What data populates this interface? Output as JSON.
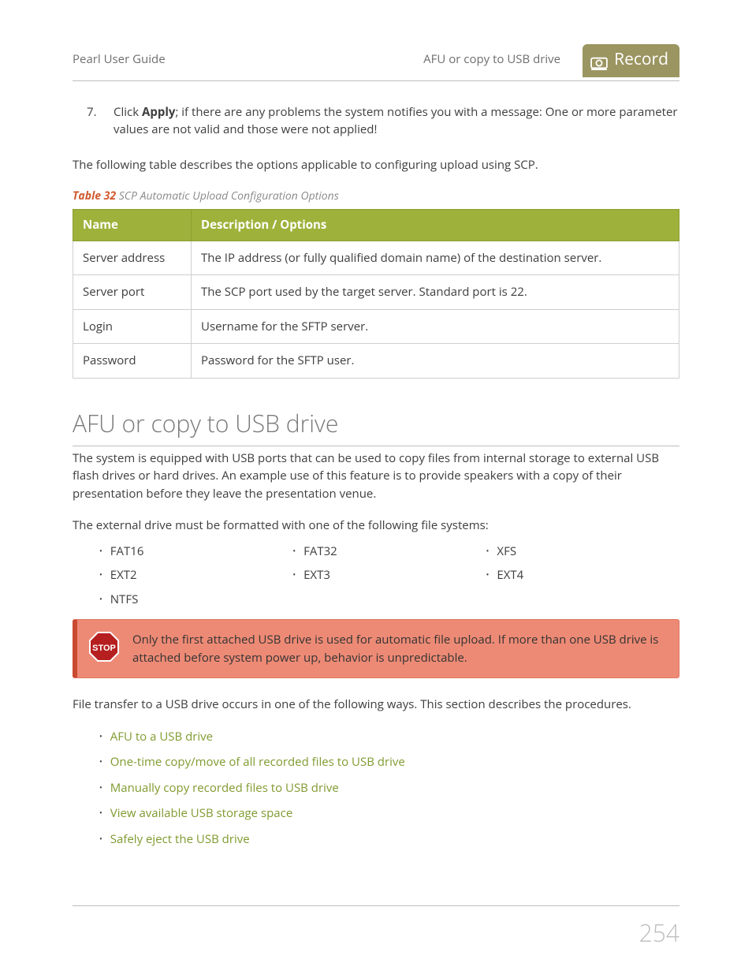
{
  "header": {
    "left": "Pearl User Guide",
    "mid": "AFU or copy to USB drive",
    "badge": "Record"
  },
  "step": {
    "num": "7.",
    "before": "Click ",
    "bold": "Apply",
    "after": "; if there are any problems the system notifies you with a message: One or more parameter values are not valid and those were not applied!"
  },
  "p_intro_table": "The following table describes the options applicable to configuring upload using SCP.",
  "table_caption": {
    "num": "Table 32",
    "title": " SCP Automatic Upload Configuration Options"
  },
  "table": {
    "h1": "Name",
    "h2": "Description / Options",
    "rows": [
      {
        "c1": "Server address",
        "c2": "The IP address (or fully qualified domain name) of the destination server."
      },
      {
        "c1": "Server port",
        "c2": "The SCP port used by the target server. Standard port is 22."
      },
      {
        "c1": "Login",
        "c2": "Username for the SFTP server."
      },
      {
        "c1": "Password",
        "c2": "Password for the SFTP user."
      }
    ]
  },
  "h2": "AFU or copy to USB drive",
  "p_usb1": "The system is equipped with USB ports that can be used to copy files from internal storage to external USB flash drives or hard drives. An example use of this feature is to provide speakers with a copy of their presentation before they leave the presentation venue.",
  "p_usb2": "The external drive must be formatted with one of the following file systems:",
  "fs": [
    "FAT16",
    "FAT32",
    "XFS",
    "EXT2",
    "EXT3",
    "EXT4",
    "NTFS"
  ],
  "stop_text": "Only the first attached USB drive is used for automatic file upload. If more than one USB drive is attached before system power up, behavior is unpredictable.",
  "p_ways": "File transfer to a USB drive occurs in one of the following ways. This section describes the procedures.",
  "links": [
    "AFU to a USB drive",
    "One-time copy/move of all recorded files to USB drive",
    "Manually copy recorded files to USB drive",
    "View available USB storage space",
    "Safely eject the USB drive"
  ],
  "page_number": "254"
}
